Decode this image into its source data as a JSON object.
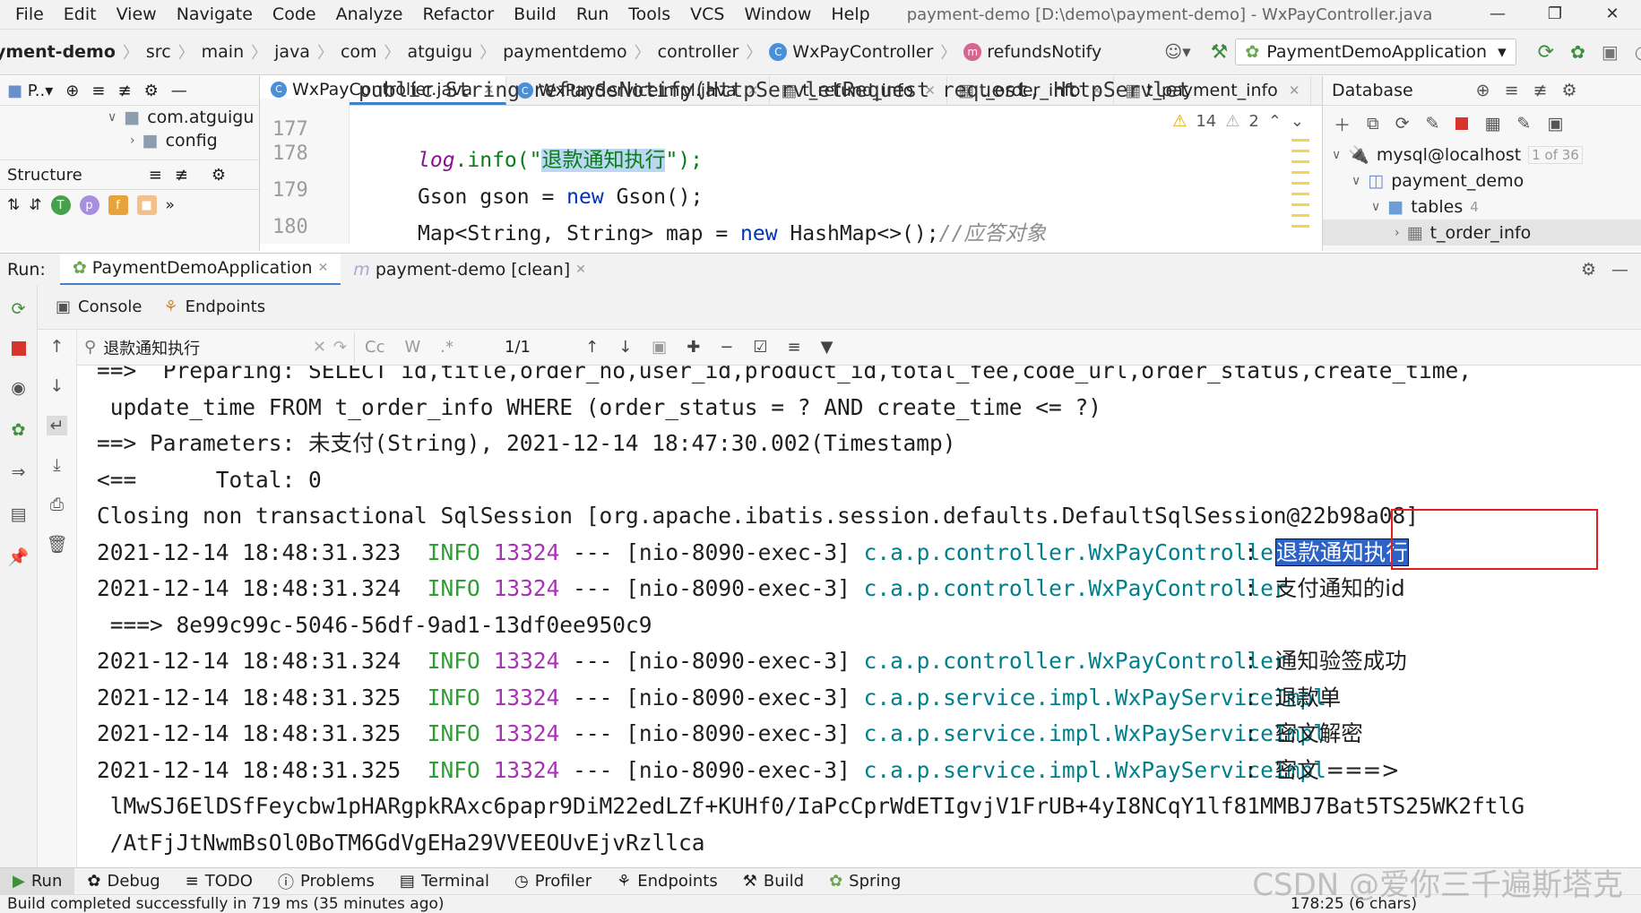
{
  "menu": {
    "items": [
      "File",
      "Edit",
      "View",
      "Navigate",
      "Code",
      "Analyze",
      "Refactor",
      "Build",
      "Run",
      "Tools",
      "VCS",
      "Window",
      "Help"
    ],
    "window_title": "payment-demo [D:\\demo\\payment-demo] - WxPayController.java"
  },
  "breadcrumb": [
    "yment-demo",
    "src",
    "main",
    "java",
    "com",
    "atguigu",
    "paymentdemo",
    "controller",
    "WxPayController",
    "refundsNotify"
  ],
  "run_config": "PaymentDemoApplication",
  "project_panel": {
    "mode": "P..",
    "tree": [
      "com.atguigu",
      "config"
    ],
    "structure_title": "Structure"
  },
  "editor": {
    "tabs": [
      "WxPayController.java",
      "WxPayServiceImpl.java",
      "t_refund_info",
      "t_order_info",
      "t_payment_info"
    ],
    "line_numbers": [
      "177",
      "178",
      "179",
      "180"
    ],
    "code": {
      "l0": "public String refundsNotify(HttpServletRequest request, HttpServlet",
      "l1": "",
      "l2_pre": "log",
      "l2_mid": ".info(\"",
      "l2_sel": "退款通知执行",
      "l2_post": "\");",
      "l3_a": "Gson gson = ",
      "l3_kw": "new",
      "l3_b": " Gson();",
      "l4_a": "Map<String, String> map = ",
      "l4_kw": "new",
      "l4_b": " HashMap<>();",
      "l4_cmt": "//应答对象"
    },
    "inspections": {
      "warnings": "14",
      "weak_warnings": "2"
    }
  },
  "database": {
    "title": "Database",
    "tree": [
      {
        "label": "mysql@localhost",
        "extra": "1 of 36"
      },
      {
        "label": "payment_demo",
        "extra": ""
      },
      {
        "label": "tables",
        "extra": "4"
      },
      {
        "label": "t_order_info",
        "extra": ""
      }
    ]
  },
  "run_window": {
    "label": "Run:",
    "tabs": [
      "PaymentDemoApplication",
      "payment-demo [clean]"
    ],
    "subtabs": [
      "Console",
      "Endpoints"
    ],
    "find": {
      "query": "退款通知执行",
      "count": "1/1"
    }
  },
  "console": {
    "lines": [
      {
        "plain": "==>  Preparing: SELECT id,title,order_no,user_id,product_id,total_fee,code_url,order_status,create_time,"
      },
      {
        "plain": " update_time FROM t_order_info WHERE (order_status = ? AND create_time <= ?)"
      },
      {
        "plain": "==> Parameters: 未支付(String), 2021-12-14 18:47:30.002(Timestamp)"
      },
      {
        "plain": "<==      Total: 0"
      },
      {
        "plain": "Closing non transactional SqlSession [org.apache.ibatis.session.defaults.DefaultSqlSession@22b98a08]"
      },
      {
        "date": "2021-12-14 18:48:31.323",
        "level": "INFO",
        "pid": "13324",
        "thread": "--- [nio-8090-exec-3]",
        "cls": "c.a.p.controller.WxPayController",
        "msg": "退款通知执行",
        "selected": true
      },
      {
        "date": "2021-12-14 18:48:31.324",
        "level": "INFO",
        "pid": "13324",
        "thread": "--- [nio-8090-exec-3]",
        "cls": "c.a.p.controller.WxPayController",
        "msg": "支付通知的id"
      },
      {
        "plain": " ===> 8e99c99c-5046-56df-9ad1-13df0ee950c9"
      },
      {
        "date": "2021-12-14 18:48:31.324",
        "level": "INFO",
        "pid": "13324",
        "thread": "--- [nio-8090-exec-3]",
        "cls": "c.a.p.controller.WxPayController",
        "msg": "通知验签成功"
      },
      {
        "date": "2021-12-14 18:48:31.325",
        "level": "INFO",
        "pid": "13324",
        "thread": "--- [nio-8090-exec-3]",
        "cls": "c.a.p.service.impl.WxPayServiceImpl",
        "msg": "退款单"
      },
      {
        "date": "2021-12-14 18:48:31.325",
        "level": "INFO",
        "pid": "13324",
        "thread": "--- [nio-8090-exec-3]",
        "cls": "c.a.p.service.impl.WxPayServiceImpl",
        "msg": "密文解密"
      },
      {
        "date": "2021-12-14 18:48:31.325",
        "level": "INFO",
        "pid": "13324",
        "thread": "--- [nio-8090-exec-3]",
        "cls": "c.a.p.service.impl.WxPayServiceImpl",
        "msg": "密文 ===>"
      },
      {
        "plain": " lMwSJ6ElDSfFeycbw1pHARgpkRAxc6papr9DiM22edLZf+KUHf0/IaPcCprWdETIgvjV1FrUB+4yI8NCqY1lf81MMBJ7Bat5TS25WK2ftlG"
      },
      {
        "plain": " /AtFjJtNwmBsOl0BoTM6GdVgEHa29VVEEOUvEjvRzllca"
      }
    ]
  },
  "bottom_tools": [
    "Run",
    "Debug",
    "TODO",
    "Problems",
    "Terminal",
    "Profiler",
    "Endpoints",
    "Build",
    "Spring"
  ],
  "status": {
    "message": "Build completed successfully in 719 ms (35 minutes ago)",
    "position": "178:25 (6 chars)"
  },
  "watermark": "CSDN @爱你三千遍斯塔克"
}
